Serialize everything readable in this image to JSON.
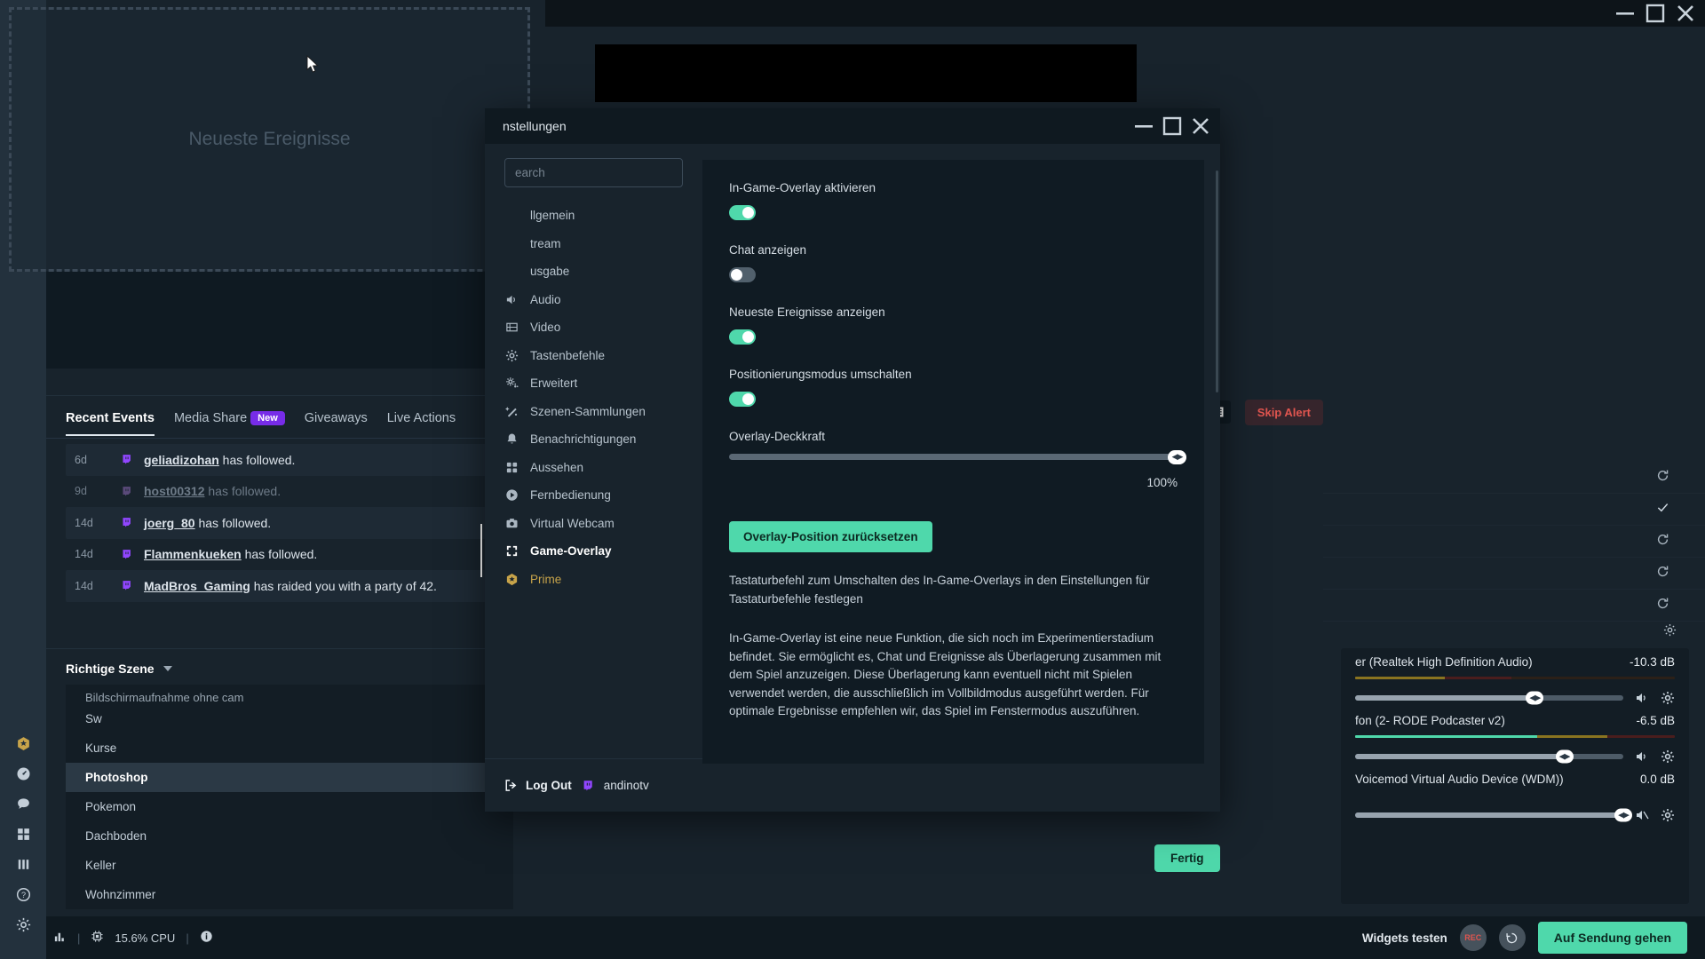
{
  "window": {
    "minimize": "–",
    "maximize": "☐",
    "close": "✕"
  },
  "overlay_region": {
    "label": "Neueste Ereignisse"
  },
  "left_rail": {
    "items": [
      {
        "name": "prime-icon",
        "label": "Prime"
      },
      {
        "name": "dashboard-icon",
        "label": "Dashboard"
      },
      {
        "name": "chat-icon",
        "label": "Chat"
      },
      {
        "name": "widgets-icon",
        "label": "Widgets"
      },
      {
        "name": "stream-icon",
        "label": "Stream"
      },
      {
        "name": "help-icon",
        "label": "Help"
      },
      {
        "name": "settings-icon",
        "label": "Einstellungen"
      }
    ]
  },
  "events_panel": {
    "tabs": [
      {
        "label": "Recent Events",
        "active": true,
        "badge": ""
      },
      {
        "label": "Media Share",
        "active": false,
        "badge": "New"
      },
      {
        "label": "Giveaways",
        "active": false,
        "badge": ""
      },
      {
        "label": "Live Actions",
        "active": false,
        "badge": ""
      }
    ],
    "rows": [
      {
        "time": "6d",
        "user": "geliadizohan",
        "text": " has followed.",
        "dim": false
      },
      {
        "time": "9d",
        "user": "host00312",
        "text": " has followed.",
        "dim": true
      },
      {
        "time": "14d",
        "user": "joerg_80",
        "text": " has followed.",
        "dim": false
      },
      {
        "time": "14d",
        "user": "Flammenkueken",
        "text": " has followed.",
        "dim": false
      },
      {
        "time": "14d",
        "user": "MadBros_Gaming",
        "text": " has raided you with a party of 42.",
        "dim": false
      }
    ]
  },
  "scenes_panel": {
    "title": "Richtige Szene",
    "items": [
      {
        "label": "Bildschirmaufnahme ohne cam",
        "selected": false,
        "clipped": true
      },
      {
        "label": "Sw",
        "selected": false
      },
      {
        "label": "Kurse",
        "selected": false
      },
      {
        "label": "Photoshop",
        "selected": true
      },
      {
        "label": "Pokemon",
        "selected": false
      },
      {
        "label": "Dachboden",
        "selected": false
      },
      {
        "label": "Keller",
        "selected": false
      },
      {
        "label": "Wohnzimmer",
        "selected": false
      }
    ]
  },
  "toolbar": {
    "icons": [
      "shield-icon",
      "chevron-down-icon",
      "copy-icon",
      "filter-icon",
      "pause-icon",
      "speaker-icon",
      "layout-split-icon",
      "layout-list-icon"
    ],
    "skip_alert_label": "Skip Alert"
  },
  "alert_rows": [
    {
      "icon": "refresh-icon"
    },
    {
      "icon": "check-icon"
    },
    {
      "icon": "refresh-icon"
    },
    {
      "icon": "refresh-icon"
    },
    {
      "icon": "refresh-icon"
    }
  ],
  "mixer": {
    "channels": [
      {
        "name": "er (Realtek High Definition Audio)",
        "db": "-10.3 dB",
        "meter": {
          "green": 0,
          "yellow": 28,
          "red": 21
        },
        "volume_pct": 67,
        "muted": false
      },
      {
        "name": "fon (2- RODE Podcaster v2)",
        "db": "-6.5 dB",
        "meter": {
          "green": 57,
          "yellow": 22,
          "red": 21
        },
        "volume_pct": 78,
        "muted": false
      },
      {
        "name": "Voicemod Virtual Audio Device (WDM))",
        "db": "0.0 dB",
        "meter": {
          "green": 0,
          "yellow": 0,
          "red": 0
        },
        "volume_pct": 100,
        "muted": true
      }
    ]
  },
  "bottom_bar": {
    "cpu": "15.6% CPU",
    "widgets_test": "Widgets testen",
    "rec_label": "REC",
    "go_live": "Auf Sendung gehen"
  },
  "done_button": {
    "label": "Fertig"
  },
  "settings": {
    "title": "nstellungen",
    "search": {
      "placeholder": "earch",
      "value": ""
    },
    "nav": [
      {
        "label": "llgemein",
        "icon": "",
        "active": false,
        "noicon": true
      },
      {
        "label": "tream",
        "icon": "",
        "active": false,
        "noicon": true
      },
      {
        "label": "usgabe",
        "icon": "",
        "active": false,
        "noicon": true
      },
      {
        "label": "Audio",
        "icon": "speaker-icon",
        "active": false
      },
      {
        "label": "Video",
        "icon": "film-icon",
        "active": false
      },
      {
        "label": "Tastenbefehle",
        "icon": "gear-icon",
        "active": false
      },
      {
        "label": "Erweitert",
        "icon": "gears-icon",
        "active": false
      },
      {
        "label": "Szenen-Sammlungen",
        "icon": "wand-icon",
        "active": false
      },
      {
        "label": "Benachrichtigungen",
        "icon": "bell-icon",
        "active": false
      },
      {
        "label": "Aussehen",
        "icon": "grid-icon",
        "active": false
      },
      {
        "label": "Fernbedienung",
        "icon": "play-circle-icon",
        "active": false
      },
      {
        "label": "Virtual Webcam",
        "icon": "camera-icon",
        "active": false
      },
      {
        "label": "Game-Overlay",
        "icon": "expand-icon",
        "active": true
      },
      {
        "label": "Prime",
        "icon": "prime-icon",
        "active": false,
        "prime": true
      }
    ],
    "footer": {
      "logout": "Log Out",
      "user": "andinotv"
    },
    "fields": [
      {
        "label": "In-Game-Overlay aktivieren",
        "state": "on"
      },
      {
        "label": "Chat anzeigen",
        "state": "off"
      },
      {
        "label": "Neueste Ereignisse anzeigen",
        "state": "on"
      },
      {
        "label": "Positionierungsmodus umschalten",
        "state": "on"
      }
    ],
    "opacity": {
      "label": "Overlay-Deckkraft",
      "value": "100%",
      "pct": 100
    },
    "reset_button": "Overlay-Position zurücksetzen",
    "paragraph1": "Tastaturbefehl zum Umschalten des In-Game-Overlays in den Einstellungen für Tastaturbefehle festlegen",
    "paragraph2": "In-Game-Overlay ist eine neue Funktion, die sich noch im Experimentierstadium befindet. Sie ermöglicht es, Chat und Ereignisse als Überlagerung zusammen mit dem Spiel anzuzeigen. Diese Überlagerung kann eventuell nicht mit Spielen verwendet werden, die ausschließlich im Vollbildmodus ausgeführt werden. Für optimale Ergebnisse empfehlen wir, das Spiel im Fenstermodus auszuführen."
  },
  "colors": {
    "accent": "#4fd8ab",
    "twitch": "#9146ff",
    "prime": "#c8a44a",
    "danger": "#e0554f"
  }
}
